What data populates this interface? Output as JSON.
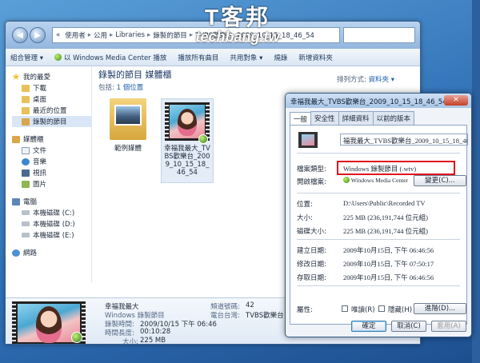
{
  "watermark": {
    "big": "T客邦",
    "small": "techbang.tw"
  },
  "explorer": {
    "address": [
      "使用者",
      "公用",
      "Libraries",
      "錄製的節目",
      "TVBS歡樂台_2009_10_15_18_46_54"
    ],
    "toolbar": [
      "組合管理 ▾",
      "以 Windows Media Center 播放",
      "播放所有曲目",
      "共用對象 ▾",
      "燒錄",
      "新增資料夾"
    ],
    "sidebar": {
      "favorites": "我的最愛",
      "fav_items": [
        "下載",
        "桌面",
        "最近的位置",
        "錄製的節目"
      ],
      "libraries": "媒體櫃",
      "lib_items": [
        "文件",
        "音樂",
        "視訊",
        "圖片"
      ],
      "computer": "電腦",
      "drives": [
        "本機磁碟 (C:)",
        "本機磁碟 (D:)",
        "本機磁碟 (E:)"
      ],
      "network": "網路"
    },
    "content": {
      "title": "錄製的節目 媒體櫃",
      "includes_label": "包括:",
      "includes_link": "1 個位置",
      "arrange_label": "排列方式:",
      "arrange_value": "資料夾 ▾"
    },
    "tiles": [
      {
        "label": "範例媒體"
      },
      {
        "label": "幸福我最大_TVBS歡樂台_2009_10_15_18_46_54"
      }
    ],
    "details": {
      "name": "幸福我最大",
      "type": "Windows 錄製節目",
      "rec_time_label": "錄製時間:",
      "rec_time": "2009/10/15 下午 06:46",
      "length_label": "時間長度:",
      "length": "00:10:28",
      "size_label": "大小:",
      "size": "225 MB",
      "channel_label": "頻道號碼:",
      "channel": "42",
      "station_label": "電台台灣:",
      "station": "TVBS歡樂台"
    }
  },
  "props": {
    "title": "幸福我最大_TVBS歡樂台_2009_10_15_18_46_54 ...",
    "close": "✕",
    "tabs": [
      "一般",
      "安全性",
      "詳細資料",
      "以前的版本"
    ],
    "filename": "福我最大_TVBS歡樂台_2009_10_15_18_46_54",
    "type_label": "檔案類型:",
    "type_value": "Windows 錄製節目 (.wtv)",
    "open_label": "開啟檔案:",
    "open_value": "Windows Media Center",
    "change_btn": "變更(C)...",
    "location_label": "位置:",
    "location_value": "D:\\Users\\Public\\Recorded TV",
    "size_label": "大小:",
    "size_value": "225 MB (236,191,744 位元組)",
    "disk_label": "磁碟大小:",
    "disk_value": "225 MB (236,191,744 位元組)",
    "created_label": "建立日期:",
    "created_value": "2009年10月15日, 下午 06:46:56",
    "modified_label": "修改日期:",
    "modified_value": "2009年10月15日, 下午 07:50:17",
    "accessed_label": "存取日期:",
    "accessed_value": "2009年10月15日, 下午 06:46:56",
    "attr_label": "屬性:",
    "readonly": "唯讀(R)",
    "hidden": "隱藏(H)",
    "advanced_btn": "進階(D)...",
    "ok": "確定",
    "cancel": "取消(C)",
    "apply": "套用(A)"
  }
}
